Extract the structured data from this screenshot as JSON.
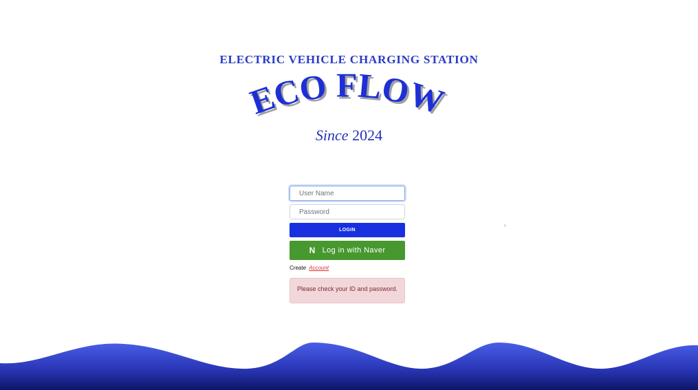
{
  "header": {
    "subtitle": "ELECTRIC VEHICLE CHARGING STATION",
    "logo_text": "ECO FLOW",
    "since_word": "Since",
    "since_year": "2024"
  },
  "form": {
    "username_placeholder": "User Name",
    "password_placeholder": "Password",
    "login_label": "LOGIN",
    "naver_icon": "N",
    "naver_label": "Log in with Naver",
    "create_text": "Create",
    "account_link": "Account",
    "error_message": "Please check your ID and password."
  },
  "colors": {
    "brand_blue": "#1830e0",
    "naver_green": "#47982f",
    "error_bg": "#f2d7da",
    "link_red": "#e03030"
  }
}
